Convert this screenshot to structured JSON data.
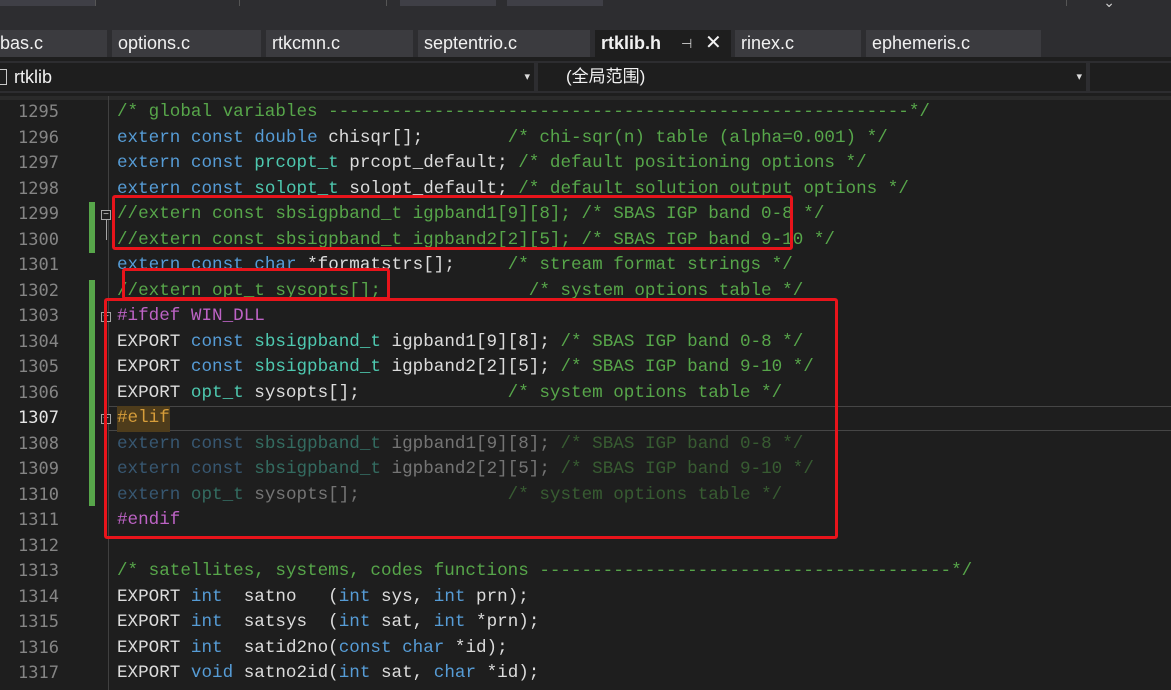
{
  "tabs": [
    {
      "label": "bas.c"
    },
    {
      "label": "options.c"
    },
    {
      "label": "rtkcmn.c"
    },
    {
      "label": "septentrio.c"
    },
    {
      "label": "rtklib.h",
      "active": true,
      "pin_glyph": "⊣",
      "close_glyph": "✕"
    },
    {
      "label": "rinex.c"
    },
    {
      "label": "ephemeris.c"
    }
  ],
  "navbar": {
    "project": "rtklib",
    "scope": "(全局范围)",
    "dropdown_glyph": "▾"
  },
  "editor": {
    "current_line": "1307",
    "colors": {
      "keyword": "#569cd6",
      "type": "#4ec9b0",
      "comment": "#57a64a",
      "macro": "#bd63c5",
      "highlight_box": "#e8141b"
    },
    "lines": [
      {
        "num": "1295",
        "text": "/* global variables -------------------------------------------------------*/"
      },
      {
        "num": "1296",
        "text": "extern const double chisqr[];        /* chi-sqr(n) table (alpha=0.001) */"
      },
      {
        "num": "1297",
        "text": "extern const prcopt_t prcopt_default; /* default positioning options */"
      },
      {
        "num": "1298",
        "text": "extern const solopt_t solopt_default; /* default solution output options */"
      },
      {
        "num": "1299",
        "text": "//extern const sbsigpband_t igpband1[9][8]; /* SBAS IGP band 0-8 */"
      },
      {
        "num": "1300",
        "text": "//extern const sbsigpband_t igpband2[2][5]; /* SBAS IGP band 9-10 */"
      },
      {
        "num": "1301",
        "text": "extern const char *formatstrs[];     /* stream format strings */"
      },
      {
        "num": "1302",
        "text": "//extern opt_t sysopts[];              /* system options table */"
      },
      {
        "num": "1303",
        "text": "#ifdef WIN_DLL"
      },
      {
        "num": "1304",
        "text": "EXPORT const sbsigpband_t igpband1[9][8]; /* SBAS IGP band 0-8 */"
      },
      {
        "num": "1305",
        "text": "EXPORT const sbsigpband_t igpband2[2][5]; /* SBAS IGP band 9-10 */"
      },
      {
        "num": "1306",
        "text": "EXPORT opt_t sysopts[];              /* system options table */"
      },
      {
        "num": "1307",
        "text": "#elif"
      },
      {
        "num": "1308",
        "text": "extern const sbsigpband_t igpband1[9][8]; /* SBAS IGP band 0-8 */"
      },
      {
        "num": "1309",
        "text": "extern const sbsigpband_t igpband2[2][5]; /* SBAS IGP band 9-10 */"
      },
      {
        "num": "1310",
        "text": "extern opt_t sysopts[];              /* system options table */"
      },
      {
        "num": "1311",
        "text": "#endif"
      },
      {
        "num": "1312",
        "text": ""
      },
      {
        "num": "1313",
        "text": "/* satellites, systems, codes functions ---------------------------------------*/"
      },
      {
        "num": "1314",
        "text": "EXPORT int  satno   (int sys, int prn);"
      },
      {
        "num": "1315",
        "text": "EXPORT int  satsys  (int sat, int *prn);"
      },
      {
        "num": "1316",
        "text": "EXPORT int  satid2no(const char *id);"
      },
      {
        "num": "1317",
        "text": "EXPORT void satno2id(int sat, char *id);"
      }
    ]
  }
}
